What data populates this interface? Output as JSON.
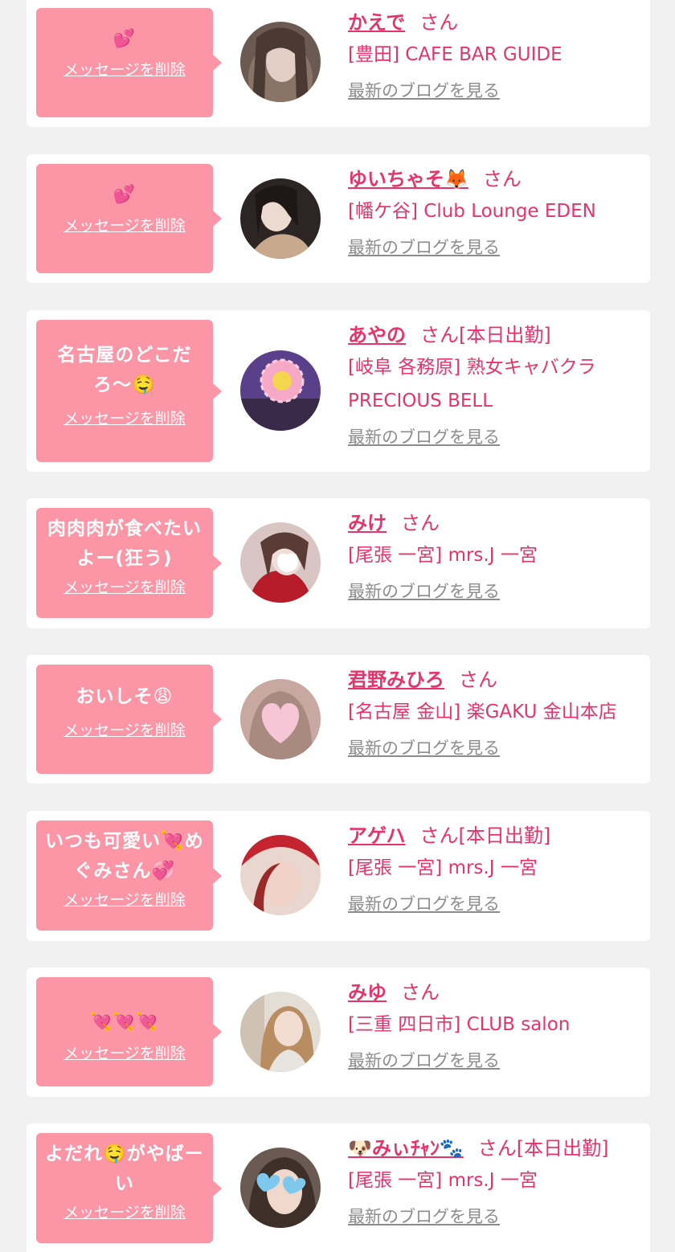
{
  "delete_label": "メッセージを削除",
  "blog_label": "最新のブログを見る",
  "san_suffix": "さん",
  "colors": {
    "background": "#f1f1f2",
    "bubble": "#fc95a6",
    "accent": "#e8336a",
    "link_gray": "#8c8c8c"
  },
  "entries": [
    {
      "message": "💕",
      "name": "かえで",
      "suffix": "さん",
      "shop": "[豊田] CAFE BAR GUIDE"
    },
    {
      "message": "💕",
      "name": "ゆいちゃそ🦊",
      "suffix": "さん",
      "shop": "[幡ケ谷] Club Lounge EDEN"
    },
    {
      "message": "名古屋のどこだろ〜🤤",
      "name": "あやの",
      "suffix": "さん[本日出勤]",
      "shop": "[岐阜 各務原] 熟女キャバクラ PRECIOUS BELL"
    },
    {
      "message": "肉肉肉が食べたいよー(狂う)",
      "name": "みけ",
      "suffix": "さん",
      "shop": "[尾張 一宮] mrs.J 一宮"
    },
    {
      "message": "おいしそ😩",
      "name": "君野みひろ",
      "suffix": "さん",
      "shop": "[名古屋 金山] 楽GAKU 金山本店"
    },
    {
      "message": "いつも可愛い💘めぐみさん💞",
      "name": "アゲハ",
      "suffix": "さん[本日出勤]",
      "shop": "[尾張 一宮] mrs.J 一宮"
    },
    {
      "message": "💘💘💘",
      "name": "みゆ",
      "suffix": "さん",
      "shop": "[三重 四日市] CLUB salon"
    },
    {
      "message": "よだれ🤤がやばーい",
      "name": "🐶みぃﾁｬﾝ🐾",
      "suffix": "さん[本日出勤]",
      "shop": "[尾張 一宮] mrs.J 一宮"
    }
  ]
}
